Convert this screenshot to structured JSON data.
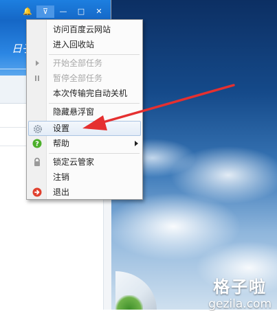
{
  "titlebar": {
    "buttons": [
      {
        "name": "notification-bell-icon",
        "glyph": "🔔"
      },
      {
        "name": "menu-dropdown-icon",
        "glyph": "⊽"
      },
      {
        "name": "minimize-icon",
        "glyph": "—"
      },
      {
        "name": "maximize-icon",
        "glyph": "□"
      },
      {
        "name": "close-icon",
        "glyph": "✕"
      }
    ]
  },
  "banner": {
    "text": "日子"
  },
  "menu": {
    "items": [
      {
        "label": "访问百度云网站"
      },
      {
        "label": "进入回收站"
      },
      {
        "label": "开始全部任务"
      },
      {
        "label": "暂停全部任务"
      },
      {
        "label": "本次传输完自动关机"
      },
      {
        "label": "隐藏悬浮窗"
      },
      {
        "label": "设置"
      },
      {
        "label": "帮助"
      },
      {
        "label": "锁定云管家"
      },
      {
        "label": "注销"
      },
      {
        "label": "退出"
      }
    ]
  },
  "watermark": {
    "title": "格子啦",
    "url": "gezila.com"
  },
  "colors": {
    "titlebar": "#1567c6",
    "arrow": "#e53030",
    "help_icon": "#4caf2a",
    "exit_icon": "#e0402e"
  }
}
